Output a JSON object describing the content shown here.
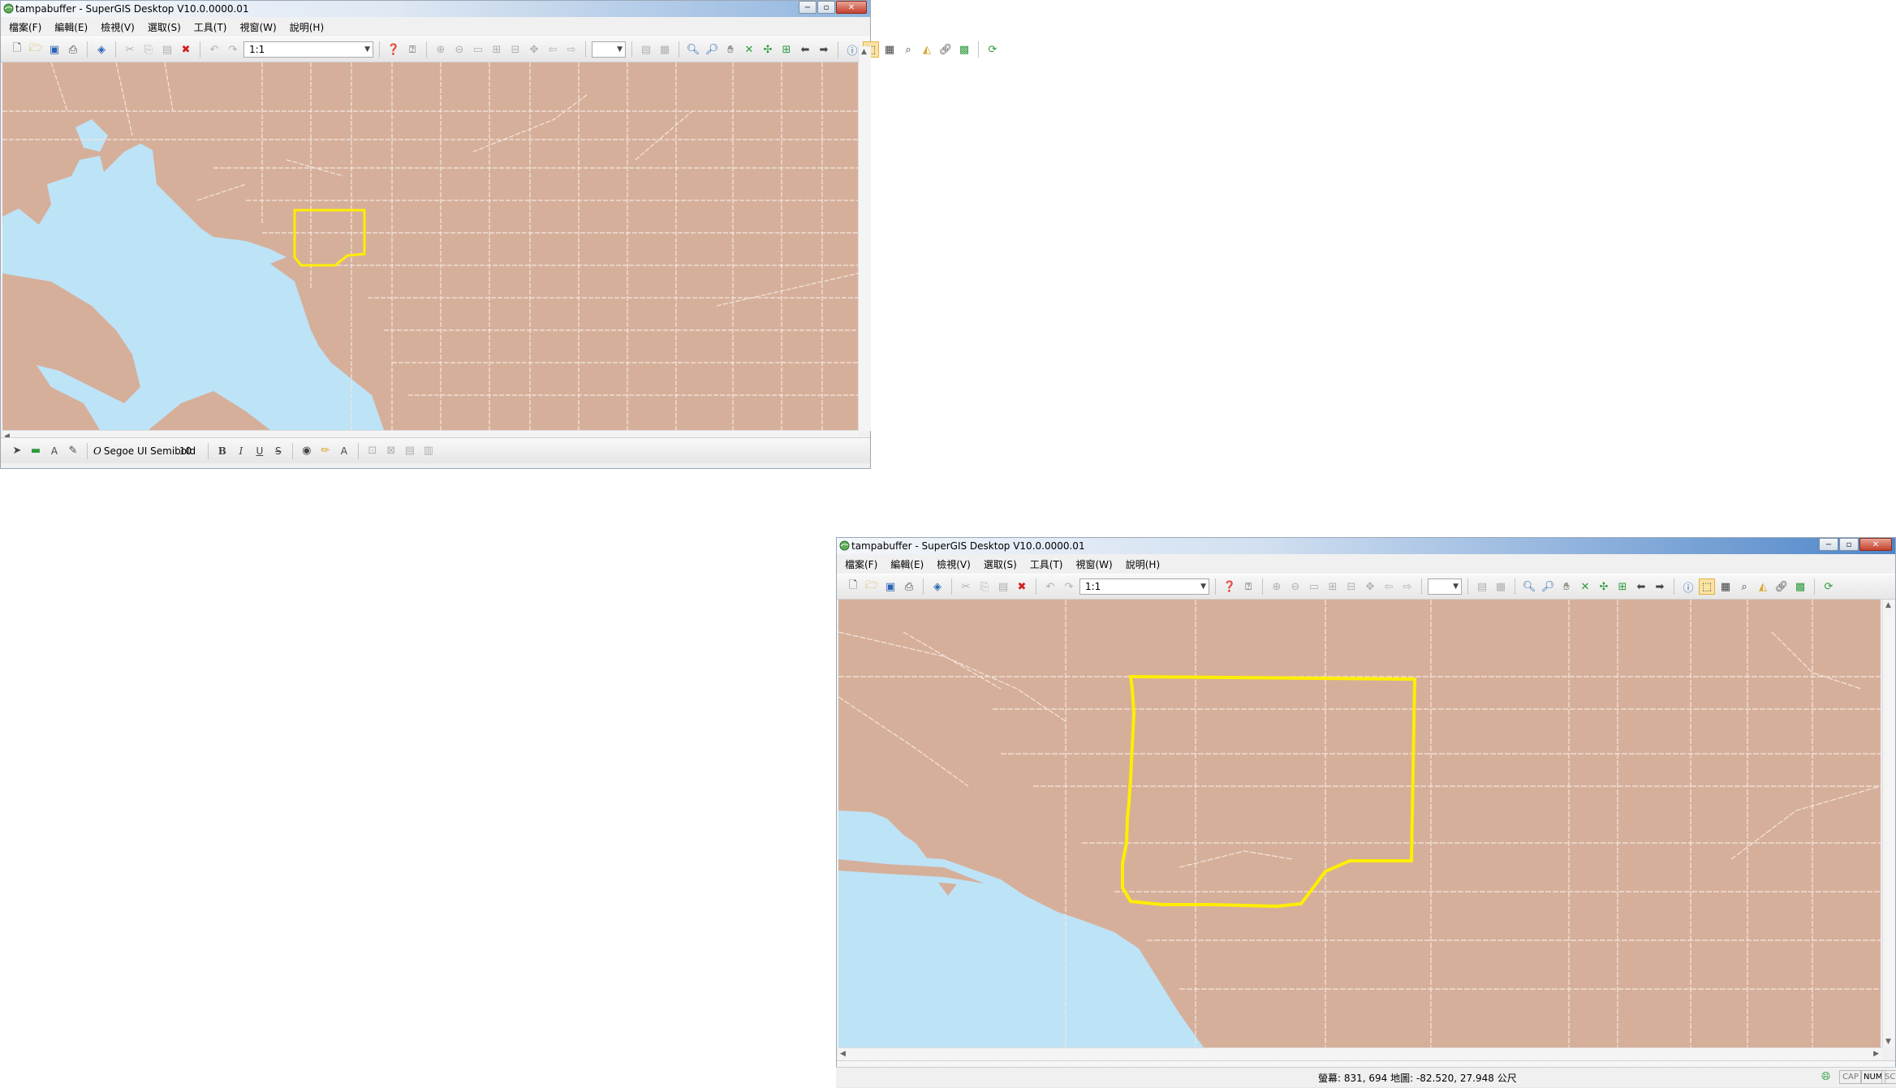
{
  "app": {
    "title": "tampabuffer - SuperGIS Desktop V10.0.0000.01"
  },
  "window_controls": {
    "minimize": "−",
    "maximize": "▫",
    "close": "✕"
  },
  "menu": {
    "items": [
      "檔案(F)",
      "編輯(E)",
      "檢視(V)",
      "選取(S)",
      "工具(T)",
      "視窗(W)",
      "說明(H)"
    ]
  },
  "toolbar": {
    "scale_value": "1:1",
    "zoom_combo_value": ""
  },
  "drawing_toolbar": {
    "font_name": "Segoe UI Semibold",
    "font_size": "10",
    "font_icon_label": "O",
    "bold_label": "B",
    "italic_label": "I",
    "underline_label": "U",
    "strike_label": "S",
    "text_tool_label": "A",
    "font_color_label": "A"
  },
  "status": {
    "coords": "螢幕: 831, 694  地圖: -82.520, 27.948 公尺",
    "indicators": [
      "CAP",
      "NUM",
      "SCRL"
    ],
    "active_indicator": "NUM"
  },
  "map": {
    "land_color": "#d6af9a",
    "water_color": "#bde3f7",
    "road_color": "#f2e6de",
    "buffer_color": "#ffee00"
  },
  "icons": {
    "new": "new-file-icon",
    "open": "open-folder-icon",
    "save": "save-icon",
    "print": "print-icon",
    "add_data": "add-data-icon",
    "cut": "cut-icon",
    "copy": "copy-icon",
    "paste": "paste-icon",
    "delete": "delete-icon",
    "undo": "undo-icon",
    "redo": "redo-icon",
    "help": "help-icon",
    "zoom_in": "zoom-in-icon",
    "zoom_out": "zoom-out-icon",
    "pan": "pan-hand-icon",
    "identify": "identify-icon",
    "refresh": "refresh-icon"
  }
}
